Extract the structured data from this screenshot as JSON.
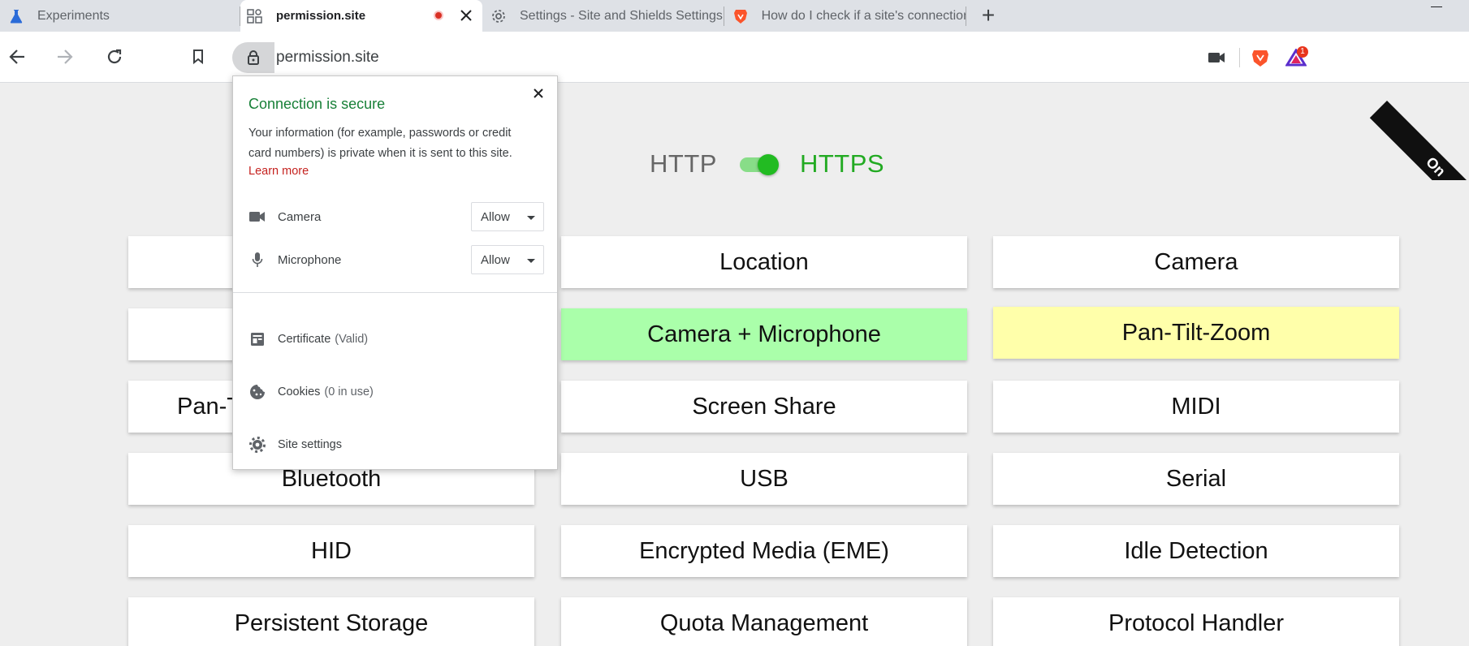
{
  "tabs": [
    {
      "title": "Experiments",
      "icon": "flask-icon"
    },
    {
      "title": "permission.site",
      "icon": "permission-site-icon",
      "recording": true,
      "active": true
    },
    {
      "title": "Settings - Site and Shields Settings",
      "icon": "gear-icon"
    },
    {
      "title": "How do I check if a site's connection is secure",
      "icon": "brave-lion-icon"
    }
  ],
  "toolbar": {
    "url": "permission.site",
    "rewards_badge": "1"
  },
  "page": {
    "ribbon_text": "On",
    "http_label": "HTTP",
    "https_label": "HTTPS",
    "https_enabled": true,
    "cards": [
      {
        "label": "",
        "color": "white"
      },
      {
        "label": "Location",
        "color": "white"
      },
      {
        "label": "Camera",
        "color": "white"
      },
      {
        "label": "",
        "color": "white"
      },
      {
        "label": "Camera + Microphone",
        "color": "#aaffaa"
      },
      {
        "label": "Pan-Tilt-Zoom",
        "color": "#ffffaa"
      },
      {
        "label": "Pan-T",
        "color": "white"
      },
      {
        "label": "Screen Share",
        "color": "white"
      },
      {
        "label": "MIDI",
        "color": "white"
      },
      {
        "label": "Bluetooth",
        "color": "white"
      },
      {
        "label": "USB",
        "color": "white"
      },
      {
        "label": "Serial",
        "color": "white"
      },
      {
        "label": "HID",
        "color": "white"
      },
      {
        "label": "Encrypted Media (EME)",
        "color": "white"
      },
      {
        "label": "Idle Detection",
        "color": "white"
      },
      {
        "label": "Persistent Storage",
        "color": "white"
      },
      {
        "label": "Quota Management",
        "color": "white"
      },
      {
        "label": "Protocol Handler",
        "color": "white"
      }
    ]
  },
  "popup": {
    "title": "Connection is secure",
    "description": "Your information (for example, passwords or credit card numbers) is private when it is sent to this site.",
    "learn_more": "Learn more",
    "permissions": [
      {
        "label": "Camera",
        "value": "Allow",
        "icon": "camera-icon"
      },
      {
        "label": "Microphone",
        "value": "Allow",
        "icon": "microphone-icon"
      }
    ],
    "certificate_label": "Certificate",
    "certificate_status": "(Valid)",
    "cookies_label": "Cookies",
    "cookies_status": "(0 in use)",
    "site_settings": "Site settings"
  },
  "colors": {
    "secure_green": "#188038",
    "learn_more_red": "#c5221f",
    "https_green": "#22aa22",
    "brave_orange": "#fb542b"
  }
}
